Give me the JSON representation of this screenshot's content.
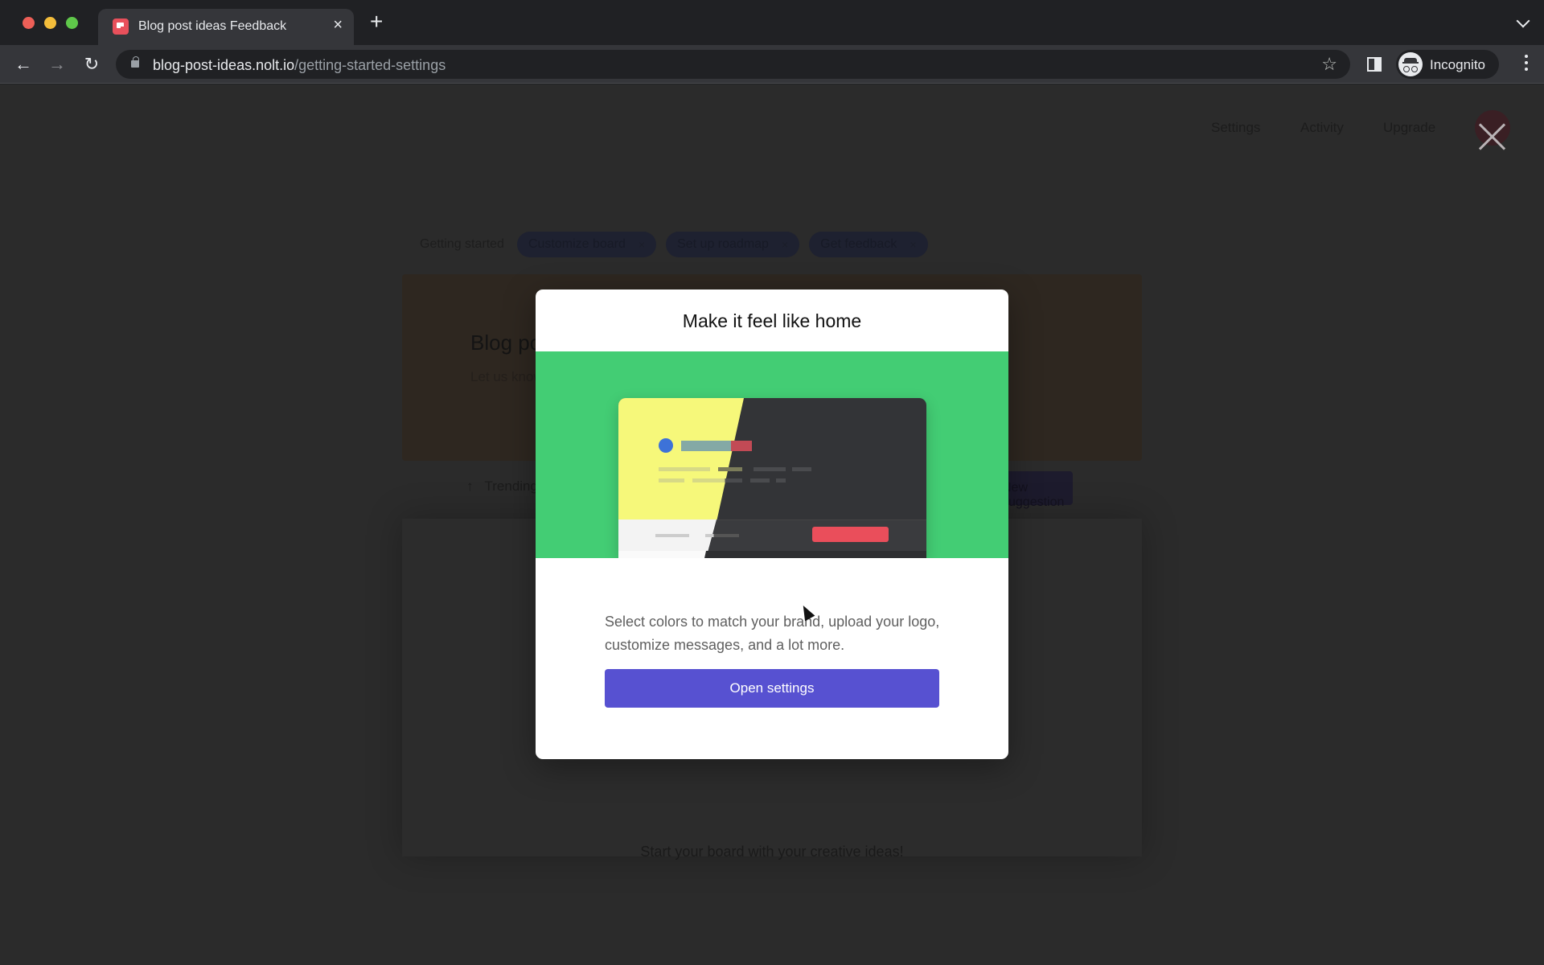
{
  "browser": {
    "tab_title": "Blog post ideas Feedback",
    "tab_close": "×",
    "new_tab": "+",
    "url_host": "blog-post-ideas.nolt.io",
    "url_path": "/getting-started-settings",
    "profile_label": "Incognito",
    "icons": {
      "back": "←",
      "forward": "→",
      "reload": "↻",
      "star": "☆"
    }
  },
  "page": {
    "nav": [
      "Settings",
      "Activity",
      "Upgrade"
    ],
    "getting_started": {
      "label": "Getting started",
      "steps": [
        {
          "label": "Customize board",
          "close": "×"
        },
        {
          "label": "Set up roadmap",
          "close": "×"
        },
        {
          "label": "Get feedback",
          "close": "×"
        }
      ]
    },
    "hero": {
      "title": "Blog post ideas",
      "description": "Let us know ... ideas ..."
    },
    "sort_label": "Trending",
    "sort_icon": "↑",
    "new_suggestion": "New suggestion",
    "empty_state": "Start your board with your creative ideas!"
  },
  "modal": {
    "title": "Make it feel like home",
    "description": "Select colors to match your brand, upload your logo, customize messages, and a lot more.",
    "button": "Open settings",
    "colors": {
      "hero_bg": "#43cd74",
      "button": "#5751d1",
      "preview_light": "#f6f87a",
      "preview_dark": "#333437",
      "preview_accent": "#ea4e5b",
      "preview_dot": "#3d72d8"
    }
  }
}
